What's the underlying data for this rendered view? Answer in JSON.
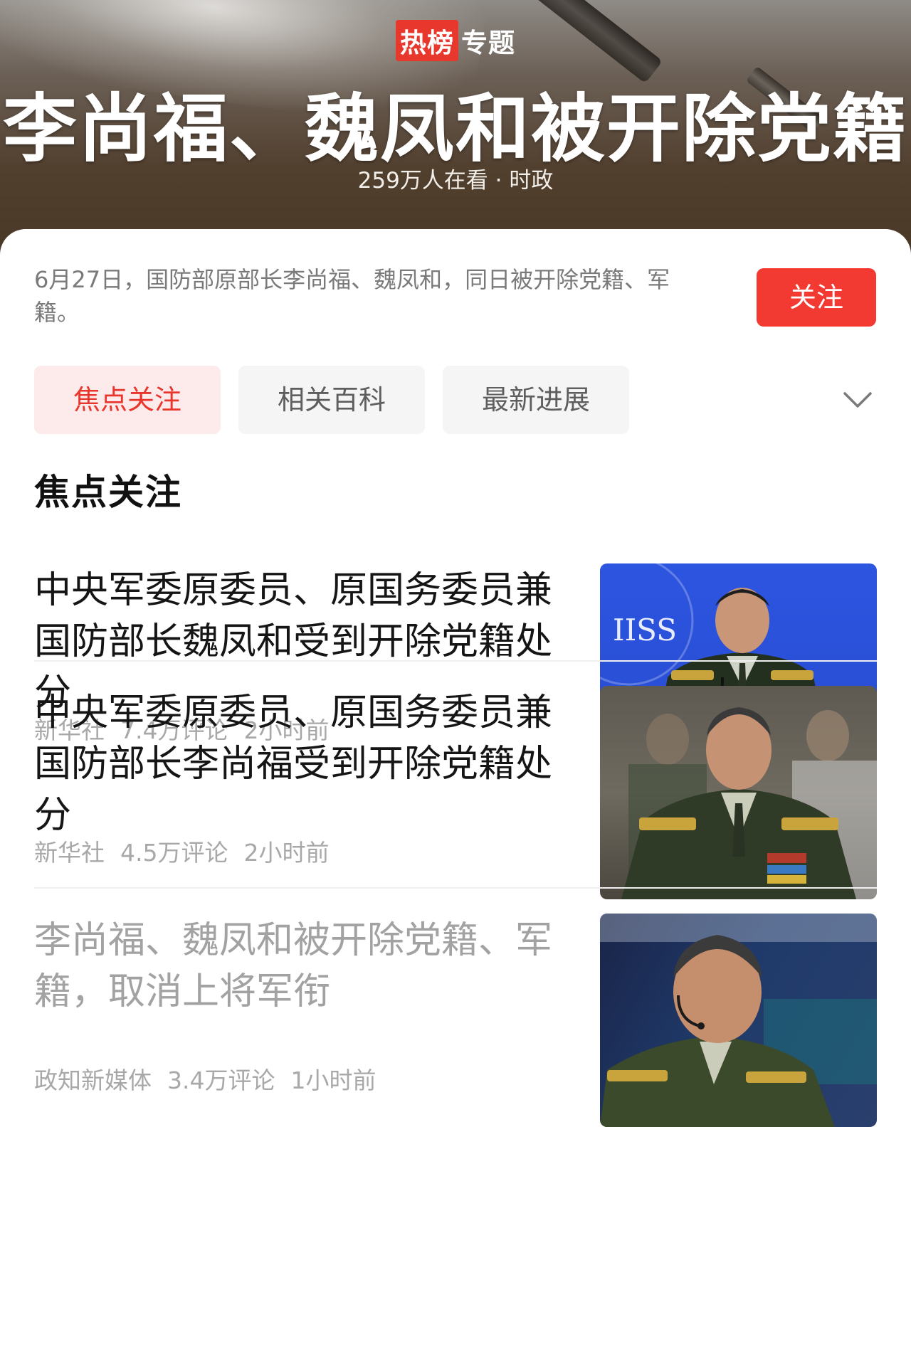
{
  "header": {
    "badge_hot": "热榜",
    "badge_topic": "专题",
    "title": "李尚福、魏凤和被开除党籍",
    "subtitle": "259万人在看 · 时政"
  },
  "summary": {
    "description": "6月27日，国防部原部长李尚福、魏凤和，同日被开除党籍、军籍。",
    "follow_label": "关注"
  },
  "tabs": [
    {
      "label": "焦点关注",
      "active": true
    },
    {
      "label": "相关百科",
      "active": false
    },
    {
      "label": "最新进展",
      "active": false
    }
  ],
  "section_title": "焦点关注",
  "articles": [
    {
      "title": "中央军委原委员、原国务委员兼国防部长魏凤和受到开除党籍处分",
      "source": "新华社",
      "comments": "7.4万评论",
      "time": "2小时前",
      "thumb_icon": "photo-speaker-podium",
      "thumb_text": "IISS",
      "read": false
    },
    {
      "title": "中央军委原委员、原国务委员兼国防部长李尚福受到开除党籍处分",
      "source": "新华社",
      "comments": "4.5万评论",
      "time": "2小时前",
      "thumb_icon": "photo-officer-portrait",
      "thumb_text": "",
      "read": false
    },
    {
      "title": "李尚福、魏凤和被开除党籍、军籍，取消上将军衔",
      "source": "政知新媒体",
      "comments": "3.4万评论",
      "time": "1小时前",
      "thumb_icon": "photo-officer-microphone",
      "thumb_text": "",
      "read": true
    }
  ],
  "colors": {
    "accent": "#f33a32",
    "accent_soft": "#fdeaea",
    "title_text": "#151515",
    "meta_text": "#a8a8a8"
  }
}
